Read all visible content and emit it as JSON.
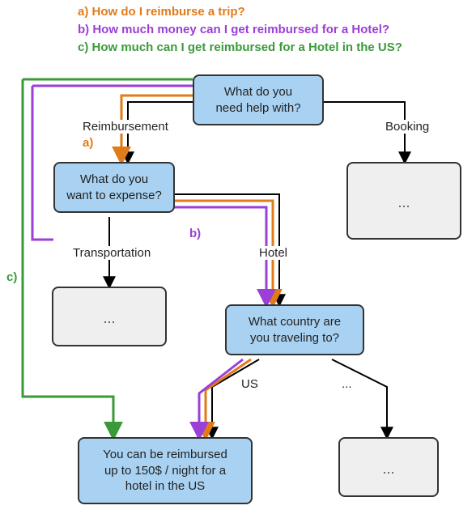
{
  "questions": {
    "a": "a) How do I reimburse a trip?",
    "b": "b) How much money can I get reimbursed for a Hotel?",
    "c": "c) How much can I get reimbursed for a Hotel in the US?"
  },
  "nodes": {
    "root": "What do you\nneed help with?",
    "expense": "What do you\nwant to expense?",
    "country": "What country are\nyou traveling to?",
    "answer": "You can be reimbursed\nup to 150$ / night for a\nhotel in the US",
    "booking_placeholder": "...",
    "transport_placeholder": "...",
    "other_country_placeholder": "..."
  },
  "edges": {
    "reimbursement": "Reimbursement",
    "booking": "Booking",
    "transportation": "Transportation",
    "hotel": "Hotel",
    "us": "US",
    "other": "..."
  },
  "path_tags": {
    "a": "a)",
    "b": "b)",
    "c": "c)"
  },
  "colors": {
    "orange": "#e07b1a",
    "purple": "#9b3fd6",
    "green": "#3a9a3a",
    "node_blue": "#a9d2f2"
  }
}
